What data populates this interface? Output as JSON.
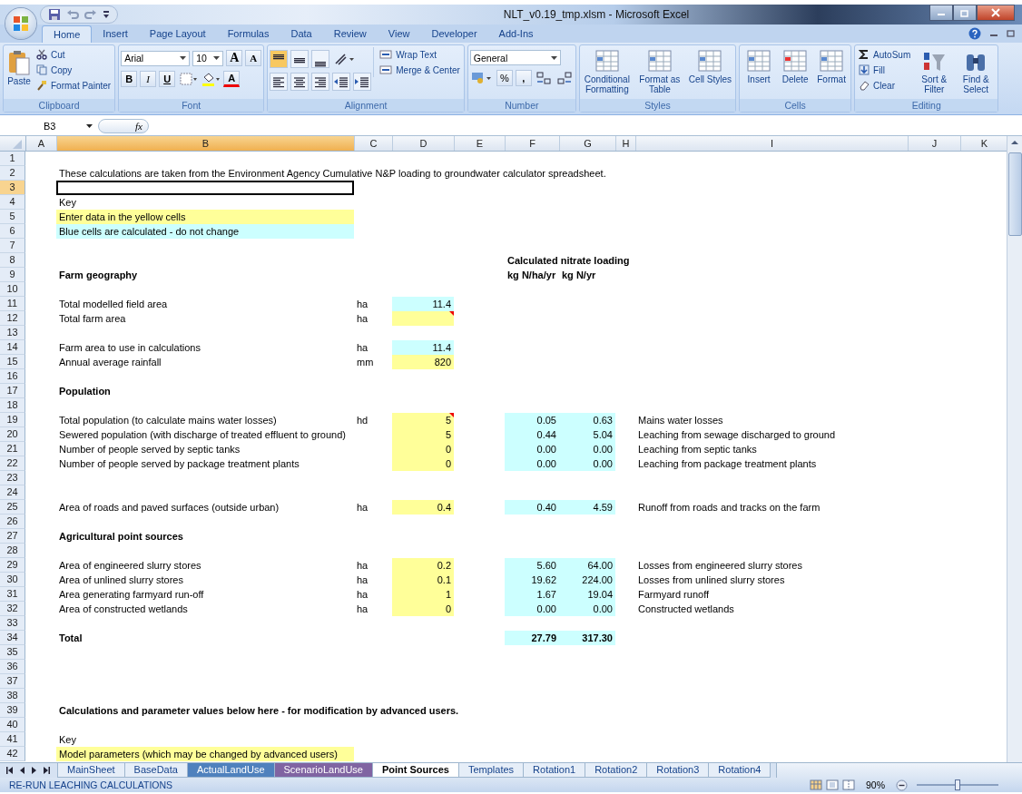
{
  "window": {
    "title": "NLT_v0.19_tmp.xlsm - Microsoft Excel"
  },
  "ribbon_tabs": [
    {
      "label": "Home",
      "selected": true
    },
    {
      "label": "Insert",
      "selected": false
    },
    {
      "label": "Page Layout",
      "selected": false
    },
    {
      "label": "Formulas",
      "selected": false
    },
    {
      "label": "Data",
      "selected": false
    },
    {
      "label": "Review",
      "selected": false
    },
    {
      "label": "View",
      "selected": false
    },
    {
      "label": "Developer",
      "selected": false
    },
    {
      "label": "Add-Ins",
      "selected": false
    }
  ],
  "ribbon_groups": [
    {
      "kind": "clipboard",
      "label": "Clipboard",
      "large": [
        "Paste"
      ],
      "small": [
        "Cut",
        "Copy",
        "Format Painter"
      ]
    },
    {
      "kind": "font",
      "label": "Font",
      "font": "Arial",
      "size": "10",
      "grow": "A",
      "shrink": "A",
      "bold": "B",
      "italic": "I",
      "underline": "U",
      "font_color_label": "A"
    },
    {
      "kind": "alignment",
      "label": "Alignment",
      "small": [
        "Wrap Text",
        "Merge & Center"
      ]
    },
    {
      "kind": "number",
      "label": "Number",
      "format": "General",
      "percent": "%",
      "comma": ","
    },
    {
      "kind": "styles",
      "label": "Styles",
      "large": [
        "Conditional Formatting",
        "Format as Table",
        "Cell Styles"
      ]
    },
    {
      "kind": "cells",
      "label": "Cells",
      "large": [
        "Insert",
        "Delete",
        "Format"
      ]
    },
    {
      "kind": "editing",
      "label": "Editing",
      "small": [
        "AutoSum",
        "Fill",
        "Clear"
      ],
      "large": [
        "Sort & Filter",
        "Find & Select"
      ]
    }
  ],
  "formula_bar": {
    "name_box": "B3",
    "fx": "fx"
  },
  "sheet": {
    "columns": [
      {
        "label": "A",
        "selected": false
      },
      {
        "label": "B",
        "selected": true
      },
      {
        "label": "C",
        "selected": false
      },
      {
        "label": "D",
        "selected": false
      },
      {
        "label": "E",
        "selected": false
      },
      {
        "label": "F",
        "selected": false
      },
      {
        "label": "G",
        "selected": false
      },
      {
        "label": "H",
        "selected": false
      },
      {
        "label": "I",
        "selected": false
      },
      {
        "label": "J",
        "selected": false
      },
      {
        "label": "K",
        "selected": false
      }
    ],
    "rows": [
      {
        "label": "1",
        "selected": false,
        "cells": {}
      },
      {
        "label": "2",
        "selected": false,
        "cells": {
          "B": {
            "kind": "label",
            "text": "These calculations are taken from the Environment Agency Cumulative N&P loading to groundwater calculator spreadsheet."
          }
        }
      },
      {
        "label": "3",
        "selected": true,
        "cells": {}
      },
      {
        "label": "4",
        "selected": false,
        "cells": {
          "B": {
            "kind": "label",
            "text": "Key"
          }
        }
      },
      {
        "label": "5",
        "selected": false,
        "cells": {
          "B": {
            "kind": "input-note",
            "text": "Enter data in the yellow cells"
          }
        }
      },
      {
        "label": "6",
        "selected": false,
        "cells": {
          "B": {
            "kind": "calculated-note",
            "text": "Blue cells are calculated - do not change"
          }
        }
      },
      {
        "label": "7",
        "selected": false,
        "cells": {}
      },
      {
        "label": "8",
        "selected": false,
        "cells": {
          "F": {
            "kind": "heading",
            "text": "Calculated nitrate loading"
          }
        }
      },
      {
        "label": "9",
        "selected": false,
        "cells": {
          "B": {
            "kind": "heading",
            "text": "Farm geography"
          },
          "F": {
            "kind": "heading",
            "text": "kg N/ha/yr"
          },
          "G": {
            "kind": "heading",
            "text": "kg N/yr"
          }
        }
      },
      {
        "label": "10",
        "selected": false,
        "cells": {}
      },
      {
        "label": "11",
        "selected": false,
        "cells": {
          "B": {
            "kind": "label",
            "text": "Total modelled field area"
          },
          "C": {
            "kind": "label",
            "text": "ha"
          },
          "D": {
            "kind": "calculated",
            "text": "11.4"
          }
        }
      },
      {
        "label": "12",
        "selected": false,
        "cells": {
          "B": {
            "kind": "label",
            "text": "Total farm area"
          },
          "C": {
            "kind": "label",
            "text": "ha"
          },
          "D": {
            "kind": "input",
            "comment": true
          }
        }
      },
      {
        "label": "13",
        "selected": false,
        "cells": {}
      },
      {
        "label": "14",
        "selected": false,
        "cells": {
          "B": {
            "kind": "label",
            "text": "Farm area to use in calculations"
          },
          "C": {
            "kind": "label",
            "text": "ha"
          },
          "D": {
            "kind": "calculated",
            "text": "11.4"
          }
        }
      },
      {
        "label": "15",
        "selected": false,
        "cells": {
          "B": {
            "kind": "label",
            "text": "Annual average rainfall"
          },
          "C": {
            "kind": "label",
            "text": "mm"
          },
          "D": {
            "kind": "input",
            "text": "820",
            "comment": false
          }
        }
      },
      {
        "label": "16",
        "selected": false,
        "cells": {}
      },
      {
        "label": "17",
        "selected": false,
        "cells": {
          "B": {
            "kind": "heading",
            "text": "Population"
          }
        }
      },
      {
        "label": "18",
        "selected": false,
        "cells": {}
      },
      {
        "label": "19",
        "selected": false,
        "cells": {
          "B": {
            "kind": "label",
            "text": "Total population (to calculate mains water losses)"
          },
          "C": {
            "kind": "label",
            "text": "hd"
          },
          "D": {
            "kind": "input",
            "text": "5",
            "comment": true
          },
          "F": {
            "kind": "calculated",
            "text": "0.05"
          },
          "G": {
            "kind": "calculated",
            "text": "0.63"
          },
          "I": {
            "kind": "label",
            "text": "Mains water losses"
          }
        }
      },
      {
        "label": "20",
        "selected": false,
        "cells": {
          "B": {
            "kind": "label",
            "text": "Sewered population (with discharge of treated effluent to ground)"
          },
          "D": {
            "kind": "input",
            "text": "5",
            "comment": false
          },
          "F": {
            "kind": "calculated",
            "text": "0.44"
          },
          "G": {
            "kind": "calculated",
            "text": "5.04"
          },
          "I": {
            "kind": "label",
            "text": "Leaching from sewage discharged to ground"
          }
        }
      },
      {
        "label": "21",
        "selected": false,
        "cells": {
          "B": {
            "kind": "label",
            "text": "Number of people served by septic tanks"
          },
          "D": {
            "kind": "input",
            "text": "0",
            "comment": false
          },
          "F": {
            "kind": "calculated",
            "text": "0.00"
          },
          "G": {
            "kind": "calculated",
            "text": "0.00"
          },
          "I": {
            "kind": "label",
            "text": "Leaching from septic tanks"
          }
        }
      },
      {
        "label": "22",
        "selected": false,
        "cells": {
          "B": {
            "kind": "label",
            "text": "Number of people served by package treatment plants"
          },
          "D": {
            "kind": "input",
            "text": "0",
            "comment": false
          },
          "F": {
            "kind": "calculated",
            "text": "0.00"
          },
          "G": {
            "kind": "calculated",
            "text": "0.00"
          },
          "I": {
            "kind": "label",
            "text": "Leaching from package treatment plants"
          }
        }
      },
      {
        "label": "23",
        "selected": false,
        "cells": {}
      },
      {
        "label": "24",
        "selected": false,
        "cells": {}
      },
      {
        "label": "25",
        "selected": false,
        "cells": {
          "B": {
            "kind": "label",
            "text": "Area of roads and paved surfaces (outside urban)"
          },
          "C": {
            "kind": "label",
            "text": "ha"
          },
          "D": {
            "kind": "input",
            "text": "0.4",
            "comment": false
          },
          "F": {
            "kind": "calculated",
            "text": "0.40"
          },
          "G": {
            "kind": "calculated",
            "text": "4.59"
          },
          "I": {
            "kind": "label",
            "text": "Runoff from roads and tracks on the farm"
          }
        }
      },
      {
        "label": "26",
        "selected": false,
        "cells": {}
      },
      {
        "label": "27",
        "selected": false,
        "cells": {
          "B": {
            "kind": "heading",
            "text": "Agricultural point sources"
          }
        }
      },
      {
        "label": "28",
        "selected": false,
        "cells": {}
      },
      {
        "label": "29",
        "selected": false,
        "cells": {
          "B": {
            "kind": "label",
            "text": "Area of engineered slurry stores"
          },
          "C": {
            "kind": "label",
            "text": "ha"
          },
          "D": {
            "kind": "input",
            "text": "0.2",
            "comment": false
          },
          "F": {
            "kind": "calculated",
            "text": "5.60"
          },
          "G": {
            "kind": "calculated",
            "text": "64.00"
          },
          "I": {
            "kind": "label",
            "text": "Losses from engineered slurry stores"
          }
        }
      },
      {
        "label": "30",
        "selected": false,
        "cells": {
          "B": {
            "kind": "label",
            "text": "Area of unlined slurry stores"
          },
          "C": {
            "kind": "label",
            "text": "ha"
          },
          "D": {
            "kind": "input",
            "text": "0.1",
            "comment": false
          },
          "F": {
            "kind": "calculated",
            "text": "19.62"
          },
          "G": {
            "kind": "calculated",
            "text": "224.00"
          },
          "I": {
            "kind": "label",
            "text": "Losses from unlined slurry stores"
          }
        }
      },
      {
        "label": "31",
        "selected": false,
        "cells": {
          "B": {
            "kind": "label",
            "text": "Area generating farmyard run-off"
          },
          "C": {
            "kind": "label",
            "text": "ha"
          },
          "D": {
            "kind": "input",
            "text": "1",
            "comment": false
          },
          "F": {
            "kind": "calculated",
            "text": "1.67"
          },
          "G": {
            "kind": "calculated",
            "text": "19.04"
          },
          "I": {
            "kind": "label",
            "text": "Farmyard runoff"
          }
        }
      },
      {
        "label": "32",
        "selected": false,
        "cells": {
          "B": {
            "kind": "label",
            "text": "Area of constructed wetlands"
          },
          "C": {
            "kind": "label",
            "text": "ha"
          },
          "D": {
            "kind": "input",
            "text": "0",
            "comment": false
          },
          "F": {
            "kind": "calculated",
            "text": "0.00"
          },
          "G": {
            "kind": "calculated",
            "text": "0.00"
          },
          "I": {
            "kind": "label",
            "text": "Constructed wetlands"
          }
        }
      },
      {
        "label": "33",
        "selected": false,
        "cells": {}
      },
      {
        "label": "34",
        "selected": false,
        "cells": {
          "B": {
            "kind": "heading",
            "text": "Total"
          },
          "F": {
            "kind": "calculated-total",
            "text": "27.79"
          },
          "G": {
            "kind": "calculated-total",
            "text": "317.30"
          }
        }
      },
      {
        "label": "35",
        "selected": false,
        "cells": {}
      },
      {
        "label": "36",
        "selected": false,
        "cells": {}
      },
      {
        "label": "37",
        "selected": false,
        "cells": {}
      },
      {
        "label": "38",
        "selected": false,
        "cells": {}
      },
      {
        "label": "39",
        "selected": false,
        "cells": {
          "B": {
            "kind": "heading",
            "text": "Calculations and parameter values below here - for modification by advanced users."
          }
        }
      },
      {
        "label": "40",
        "selected": false,
        "cells": {}
      },
      {
        "label": "41",
        "selected": false,
        "cells": {
          "B": {
            "kind": "label",
            "text": "Key"
          }
        }
      },
      {
        "label": "42",
        "selected": false,
        "cells": {
          "B": {
            "kind": "input-note",
            "text": "Model parameters (which may be changed by advanced users)"
          }
        }
      }
    ]
  },
  "sheet_tabs": [
    {
      "label": "MainSheet",
      "selected": false
    },
    {
      "label": "BaseData",
      "selected": false
    },
    {
      "label": "ActualLandUse",
      "selected": false,
      "color": "#4f81bd"
    },
    {
      "label": "ScenarioLandUse",
      "selected": false,
      "color": "#8064a2"
    },
    {
      "label": "Point Sources",
      "selected": true
    },
    {
      "label": "Templates",
      "selected": false
    },
    {
      "label": "Rotation1",
      "selected": false
    },
    {
      "label": "Rotation2",
      "selected": false
    },
    {
      "label": "Rotation3",
      "selected": false
    },
    {
      "label": "Rotation4",
      "selected": false
    }
  ],
  "status_bar": {
    "message": "RE-RUN LEACHING CALCULATIONS",
    "zoom": "90%",
    "zoom_slider": {
      "level": 0.5
    }
  }
}
